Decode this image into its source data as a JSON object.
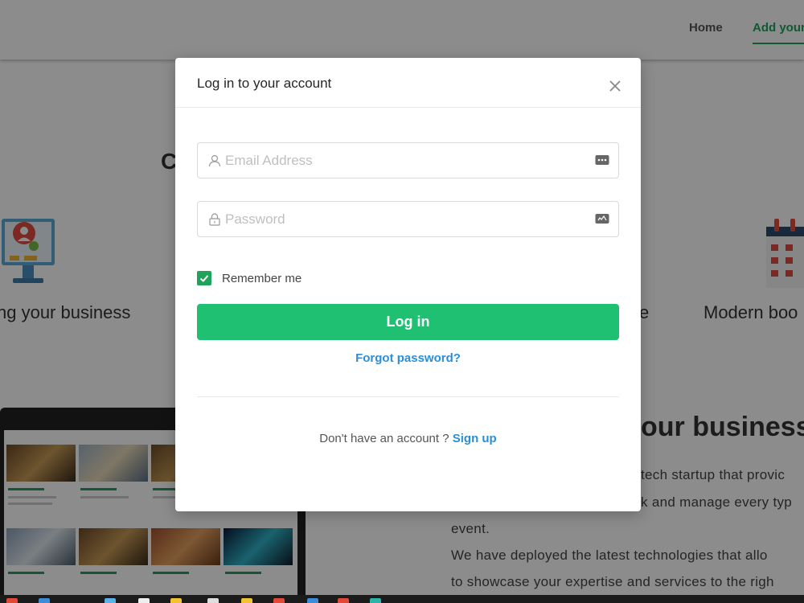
{
  "nav": {
    "home": "Home",
    "add": "Add your"
  },
  "background": {
    "heading_fragment": "C",
    "feature_left": "ng your business",
    "feature_mid": "e",
    "feature_right": "Modern boo",
    "about_title": "our business",
    "about_line1": "tech startup that provic",
    "about_line2": "k and manage every typ",
    "about_line3": "event.",
    "about_line4": "We have deployed the latest technologies that allo",
    "about_line5": "to showcase your expertise and services to the righ"
  },
  "modal": {
    "title": "Log in to your account",
    "email_placeholder": "Email Address",
    "email_value": "",
    "password_placeholder": "Password",
    "password_value": "",
    "remember_label": "Remember me",
    "remember_checked": true,
    "login_label": "Log in",
    "forgot_label": "Forgot password?",
    "no_account_text": "Don't have an account ? ",
    "signup_label": "Sign up"
  },
  "colors": {
    "accent_green": "#20c073",
    "nav_active_green": "#1fa35a",
    "link_blue": "#2a8fd8"
  }
}
